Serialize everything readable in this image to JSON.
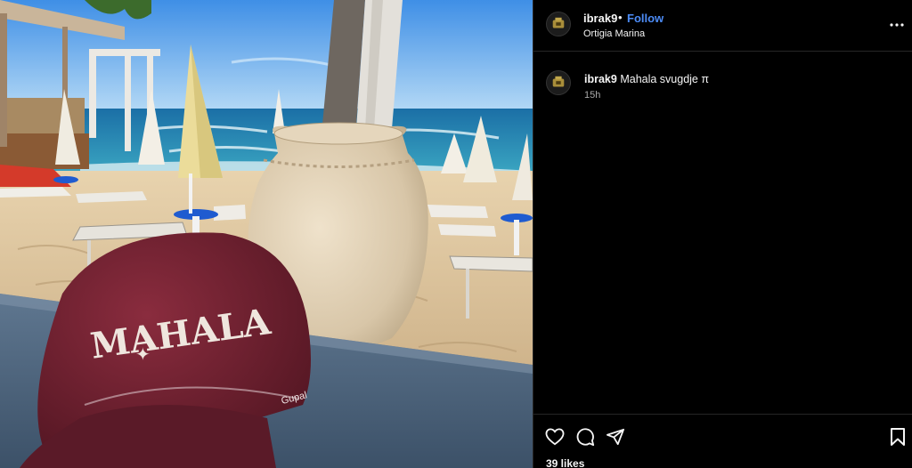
{
  "photo": {
    "cap_text": "MAHALA",
    "cap_tag": "Gupal"
  },
  "post": {
    "username": "ibrak9",
    "separator": "•",
    "follow_label": "Follow",
    "location": "Ortigia Marina",
    "caption_text": "Mahala svugdje π",
    "time_ago": "15h",
    "likes": "39 likes"
  },
  "icons": {
    "avatar": "emblem-icon",
    "more": "more-options-icon",
    "like": "heart-icon",
    "comment": "comment-icon",
    "share": "send-icon",
    "save": "bookmark-icon"
  },
  "colors": {
    "background": "#000000",
    "follow_blue": "#4c8bf5",
    "divider": "#262626"
  }
}
